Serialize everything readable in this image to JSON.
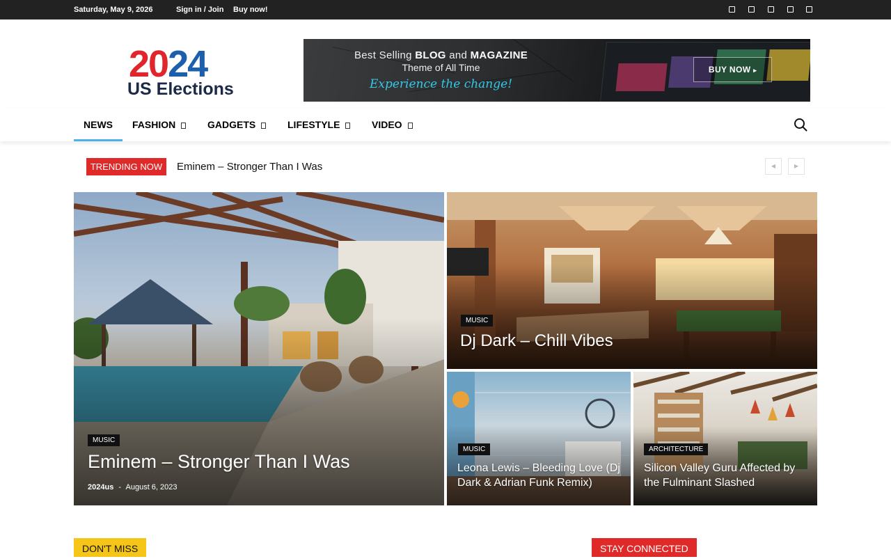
{
  "topbar": {
    "date": "Saturday, May 9, 2026",
    "signin": "Sign in / Join",
    "buy": "Buy now!",
    "social_icons": [
      "facebook-icon",
      "instagram-icon",
      "twitter-icon",
      "vimeo-icon",
      "youtube-icon"
    ]
  },
  "logo": {
    "year_a": "20",
    "year_b": "24",
    "subtitle": "US Elections"
  },
  "ad": {
    "line1_pre": "Best Selling ",
    "line1_b1": "BLOG",
    "line1_mid": " and ",
    "line1_b2": "MAGAZINE",
    "line2": "Theme of All Time",
    "line3": "Experience the change!",
    "button": "BUY NOW"
  },
  "nav": {
    "items": [
      "NEWS",
      "FASHION",
      "GADGETS",
      "LIFESTYLE",
      "VIDEO"
    ],
    "active": "NEWS"
  },
  "trending": {
    "label": "TRENDING NOW",
    "text": "Eminem – Stronger Than I Was"
  },
  "posts": [
    {
      "category": "MUSIC",
      "title": "Eminem – Stronger Than I Was",
      "author": "2024us",
      "sep": "-",
      "date": "August 6, 2023"
    },
    {
      "category": "MUSIC",
      "title": "Dj Dark – Chill Vibes"
    },
    {
      "category": "MUSIC",
      "title": "Leona Lewis – Bleeding Love (Dj Dark & Adrian Funk Remix)"
    },
    {
      "category": "ARCHITECTURE",
      "title": "Silicon Valley Guru Affected by the Fulminant Slashed"
    }
  ],
  "sections": {
    "dont_miss": "DON'T MISS",
    "stay_connected": "STAY CONNECTED"
  },
  "colors": {
    "accent": "#4db2ec",
    "trending": "#e02a2a",
    "dont_miss": "#f5c518",
    "stay_connected": "#e02a2a",
    "topbar": "#222222"
  }
}
